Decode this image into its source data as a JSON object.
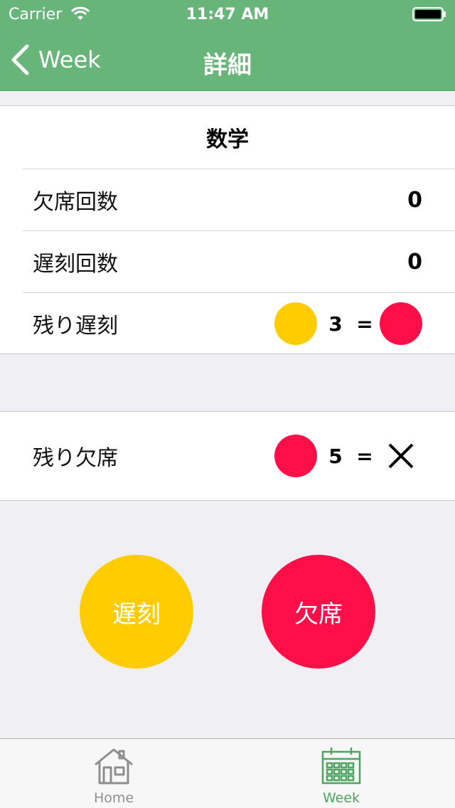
{
  "status": {
    "carrier": "Carrier",
    "time": "11:47 AM"
  },
  "nav": {
    "back_label": "Week",
    "title": "詳細"
  },
  "subject": "数学",
  "rows": [
    {
      "label": "欠席回数",
      "value": "0"
    },
    {
      "label": "遅刻回数",
      "value": "0"
    }
  ],
  "remaining_late": {
    "label": "残り遅刻",
    "count": "3",
    "equals": "="
  },
  "remaining_absent": {
    "label": "残り欠席",
    "count": "5",
    "equals": "="
  },
  "actions": {
    "late": "遅刻",
    "absent": "欠席"
  },
  "tabs": [
    {
      "label": "Home",
      "icon": "house-icon",
      "active": false
    },
    {
      "label": "Week",
      "icon": "calendar-icon",
      "active": true
    }
  ],
  "colors": {
    "nav": "#68b57a",
    "late": "#ffcc00",
    "absent": "#ff0f47",
    "tab_active": "#4ca65f",
    "tab_inactive": "#8e8e8e"
  }
}
